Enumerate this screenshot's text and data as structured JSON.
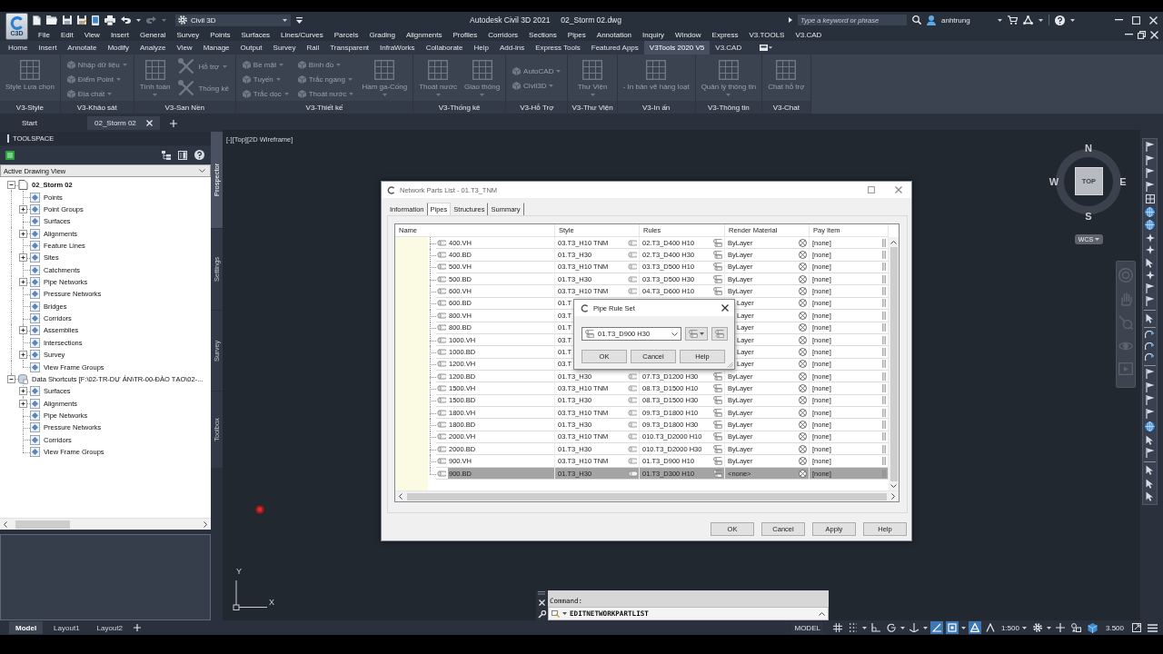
{
  "title_bar": {
    "logo_caption": "C3D",
    "workspace": "Civil 3D",
    "app_title": "Autodesk Civil 3D 2021",
    "file_name": "02_Storm 02.dwg",
    "search": {
      "placeholder": "Type a keyword or phrase"
    },
    "user": "anhtrung"
  },
  "menu_bar": [
    "File",
    "Edit",
    "View",
    "Insert",
    "General",
    "Survey",
    "Points",
    "Surfaces",
    "Lines/Curves",
    "Parcels",
    "Grading",
    "Alignments",
    "Profiles",
    "Corridors",
    "Sections",
    "Pipes",
    "Annotation",
    "Inquiry",
    "Window",
    "Express",
    "V3.TOOLS",
    "V3.CAD"
  ],
  "ribbon": {
    "tabs": [
      {
        "label": "Home",
        "selected": false
      },
      {
        "label": "Insert",
        "selected": false
      },
      {
        "label": "Annotate",
        "selected": false
      },
      {
        "label": "Modify",
        "selected": false
      },
      {
        "label": "Analyze",
        "selected": false
      },
      {
        "label": "View",
        "selected": false
      },
      {
        "label": "Manage",
        "selected": false
      },
      {
        "label": "Output",
        "selected": false
      },
      {
        "label": "Survey",
        "selected": false
      },
      {
        "label": "Rail",
        "selected": false
      },
      {
        "label": "Transparent",
        "selected": false
      },
      {
        "label": "InfraWorks",
        "selected": false
      },
      {
        "label": "Collaborate",
        "selected": false
      },
      {
        "label": "Help",
        "selected": false
      },
      {
        "label": "Add-ins",
        "selected": false
      },
      {
        "label": "Express Tools",
        "selected": false
      },
      {
        "label": "Featured Apps",
        "selected": false
      },
      {
        "label": "V3Tools 2020 V5",
        "selected": true
      },
      {
        "label": "V3.CAD",
        "selected": false
      }
    ],
    "panels": [
      {
        "title": "V3-Style",
        "tools": [
          {
            "label": "Style Lựa chọn",
            "kind": "large",
            "dropdown": false,
            "disabled": true
          }
        ]
      },
      {
        "title": "V3-Khảo sát",
        "tools": [
          {
            "label": "Nhập dữ liệu",
            "kind": "small",
            "dropdown": true,
            "disabled": true
          },
          {
            "label": "Điểm Point",
            "kind": "small",
            "dropdown": true,
            "disabled": true
          },
          {
            "label": "Địa chất",
            "kind": "small",
            "dropdown": true,
            "disabled": true
          }
        ]
      },
      {
        "title": "V3-San Nền",
        "tools": [
          {
            "label": "Tính toán",
            "kind": "large",
            "dropdown": true,
            "disabled": true
          },
          {
            "label": "Hỗ trợ",
            "kind": "medium",
            "dropdown": true,
            "disabled": true
          },
          {
            "label": "Thống kê",
            "kind": "medium",
            "dropdown": false,
            "disabled": true
          }
        ]
      },
      {
        "title": "V3-Thiết kế",
        "tools": [
          {
            "label": "Bề mặt",
            "kind": "small",
            "dropdown": true,
            "disabled": true
          },
          {
            "label": "Tuyến",
            "kind": "small",
            "dropdown": true,
            "disabled": true
          },
          {
            "label": "Trắc dọc",
            "kind": "small",
            "dropdown": true,
            "disabled": true
          },
          {
            "label": "Bình đồ",
            "kind": "small",
            "dropdown": true,
            "disabled": true
          },
          {
            "label": "Trắc ngang",
            "kind": "small",
            "dropdown": true,
            "disabled": true
          },
          {
            "label": "Thoát nước",
            "kind": "small",
            "dropdown": true,
            "disabled": true
          },
          {
            "label": "Hầm ga-Cống",
            "kind": "large",
            "dropdown": true,
            "disabled": true
          }
        ]
      },
      {
        "title": "V3-Thống kê",
        "tools": [
          {
            "label": "Thoát nước",
            "kind": "large",
            "dropdown": true,
            "disabled": true
          },
          {
            "label": "Giao thông",
            "kind": "large",
            "dropdown": true,
            "disabled": true
          }
        ]
      },
      {
        "title": "V3-Hỗ Trợ",
        "tools": [
          {
            "label": "AutoCAD",
            "kind": "small",
            "dropdown": true,
            "disabled": true
          },
          {
            "label": "Civil3D",
            "kind": "small",
            "dropdown": true,
            "disabled": true
          }
        ]
      },
      {
        "title": "V3-Thư Viện",
        "tools": [
          {
            "label": "Thư Viện",
            "kind": "large",
            "dropdown": true,
            "disabled": true
          }
        ]
      },
      {
        "title": "V3-In ấn",
        "tools": [
          {
            "label": "- In bản vẽ hàng loạt",
            "kind": "large",
            "dropdown": false,
            "disabled": true
          }
        ]
      },
      {
        "title": "V3-Thông tin",
        "tools": [
          {
            "label": "Quản lý thông tin",
            "kind": "large",
            "dropdown": true,
            "disabled": true
          }
        ]
      },
      {
        "title": "V3-Chat",
        "tools": [
          {
            "label": "Chat hỗ trợ",
            "kind": "large",
            "dropdown": false,
            "disabled": true
          }
        ]
      }
    ]
  },
  "file_tabs": [
    {
      "label": "Start",
      "selected": false
    },
    {
      "label": "02_Storm 02",
      "selected": true
    }
  ],
  "toolspace": {
    "title": "TOOLSPACE",
    "view": "Active Drawing View",
    "tree": [
      {
        "label": "02_Storm 02",
        "kind": "drawing",
        "expanded": true,
        "children": [
          {
            "label": "Points"
          },
          {
            "label": "Point Groups",
            "expanded": false
          },
          {
            "label": "Surfaces"
          },
          {
            "label": "Alignments",
            "expanded": false
          },
          {
            "label": "Feature Lines"
          },
          {
            "label": "Sites",
            "expanded": false
          },
          {
            "label": "Catchments"
          },
          {
            "label": "Pipe Networks",
            "expanded": false
          },
          {
            "label": "Pressure Networks"
          },
          {
            "label": "Bridges"
          },
          {
            "label": "Corridors"
          },
          {
            "label": "Assemblies",
            "expanded": false
          },
          {
            "label": "Intersections"
          },
          {
            "label": "Survey",
            "expanded": false
          },
          {
            "label": "View Frame Groups"
          }
        ]
      },
      {
        "label": "Data Shortcuts [F:\\02-TR-DỰ ÁN\\TR-00-ĐÀO TẠO\\02-...",
        "kind": "shortcuts",
        "expanded": true,
        "children": [
          {
            "label": "Surfaces",
            "expanded": false
          },
          {
            "label": "Alignments",
            "expanded": false
          },
          {
            "label": "Pipe Networks"
          },
          {
            "label": "Pressure Networks"
          },
          {
            "label": "Corridors"
          },
          {
            "label": "View Frame Groups"
          }
        ]
      }
    ],
    "side_tabs": [
      {
        "label": "Prospector",
        "selected": true
      },
      {
        "label": "Settings",
        "selected": false
      },
      {
        "label": "Survey",
        "selected": false
      },
      {
        "label": "Toolbox",
        "selected": false
      }
    ]
  },
  "viewport": {
    "controls": "[-][Top][2D Wireframe]",
    "view_cube": {
      "north": "N",
      "west": "W",
      "east": "E",
      "south": "S",
      "face": "TOP",
      "ucs": "WCS"
    },
    "ucs_icon": {
      "y_axis": "Y",
      "x_axis": "X"
    }
  },
  "dialog": {
    "title": "Network Parts List - 01.T3_TNM",
    "tabs": [
      {
        "label": "Information",
        "selected": false
      },
      {
        "label": "Pipes",
        "selected": true
      },
      {
        "label": "Structures",
        "selected": false
      },
      {
        "label": "Summary",
        "selected": false
      }
    ],
    "table": {
      "columns": [
        "Name",
        "Style",
        "Rules",
        "Render Material",
        "Pay Item"
      ],
      "rows": [
        {
          "name": "400.VH",
          "style": "03.T3_H10 TNM",
          "rules": "02.T3_D400 H10",
          "render_material": "ByLayer",
          "pay_item": "[none]",
          "selected": false
        },
        {
          "name": "400.BD",
          "style": "01.T3_H30",
          "rules": "02.T3_D400 H30",
          "render_material": "ByLayer",
          "pay_item": "[none]",
          "selected": false
        },
        {
          "name": "500.VH",
          "style": "03.T3_H10 TNM",
          "rules": "03.T3_D500 H10",
          "render_material": "ByLayer",
          "pay_item": "[none]",
          "selected": false
        },
        {
          "name": "500.BD",
          "style": "01.T3_H30",
          "rules": "03.T3_D500 H30",
          "render_material": "ByLayer",
          "pay_item": "[none]",
          "selected": false
        },
        {
          "name": "600.VH",
          "style": "03.T3_H10 TNM",
          "rules": "04.T3_D600 H10",
          "render_material": "ByLayer",
          "pay_item": "[none]",
          "selected": false
        },
        {
          "name": "600.BD",
          "style": "01.T",
          "render_material": "Layer",
          "pay_item": "[none]",
          "selected": false
        },
        {
          "name": "800.VH",
          "style": "03.T",
          "render_material": "Layer",
          "pay_item": "[none]",
          "selected": false
        },
        {
          "name": "800.BD",
          "style": "01.T",
          "render_material": "Layer",
          "pay_item": "[none]",
          "selected": false
        },
        {
          "name": "1000.VH",
          "style": "03.T",
          "render_material": "Layer",
          "pay_item": "[none]",
          "selected": false
        },
        {
          "name": "1000.BD",
          "style": "01.T",
          "render_material": "Layer",
          "pay_item": "[none]",
          "selected": false
        },
        {
          "name": "1200.VH",
          "style": "03.T",
          "render_material": "Layer",
          "pay_item": "[none]",
          "selected": false
        },
        {
          "name": "1200.BD",
          "style": "01.T3_H30",
          "rules": "07.T3_D1200 H30",
          "render_material": "ByLayer",
          "pay_item": "[none]",
          "selected": false
        },
        {
          "name": "1500.VH",
          "style": "03.T3_H10 TNM",
          "rules": "08.T3_D1500 H10",
          "render_material": "ByLayer",
          "pay_item": "[none]",
          "selected": false
        },
        {
          "name": "1500.BD",
          "style": "01.T3_H30",
          "rules": "08.T3_D1500 H30",
          "render_material": "ByLayer",
          "pay_item": "[none]",
          "selected": false
        },
        {
          "name": "1800.VH",
          "style": "03.T3_H10 TNM",
          "rules": "09.T3_D1800 H10",
          "render_material": "ByLayer",
          "pay_item": "[none]",
          "selected": false
        },
        {
          "name": "1800.BD",
          "style": "01.T3_H30",
          "rules": "09.T3_D1800 H30",
          "render_material": "ByLayer",
          "pay_item": "[none]",
          "selected": false
        },
        {
          "name": "2000.VH",
          "style": "03.T3_H10 TNM",
          "rules": "010.T3_D2000 H10",
          "render_material": "ByLayer",
          "pay_item": "[none]",
          "selected": false
        },
        {
          "name": "2000.BD",
          "style": "01.T3_H30",
          "rules": "010.T3_D2000 H30",
          "render_material": "ByLayer",
          "pay_item": "[none]",
          "selected": false
        },
        {
          "name": "900.VH",
          "style": "03.T3_H10 TNM",
          "rules": "01.T3_D900 H10",
          "render_material": "ByLayer",
          "pay_item": "[none]",
          "selected": false
        },
        {
          "name": "900.BD",
          "style": "01.T3_H30",
          "rules": "01.T3_D300 H10",
          "render_material": "<none>",
          "pay_item": "[none]",
          "selected": true
        }
      ]
    },
    "buttons": [
      "OK",
      "Cancel",
      "Apply",
      "Help"
    ],
    "rule_set_dialog": {
      "title": "Pipe Rule Set",
      "value": "01.T3_D900 H30",
      "buttons": [
        "OK",
        "Cancel",
        "Help"
      ]
    }
  },
  "command_line": {
    "prompt": "Command:",
    "value": "EDITNETWORKPARTLIST"
  },
  "layout_tabs": [
    {
      "label": "Model",
      "selected": true
    },
    {
      "label": "Layout1",
      "selected": false
    },
    {
      "label": "Layout2",
      "selected": false
    }
  ],
  "status_bar": {
    "mode": "MODEL",
    "toggles": [
      {
        "on": false
      },
      {
        "on": false
      },
      {
        "on": false
      },
      {
        "on": false
      },
      {
        "on": false
      },
      {
        "on": true
      },
      {
        "on": true
      },
      {
        "on": true
      },
      {
        "on": false
      }
    ],
    "scale": "1:500",
    "value": "3.500"
  }
}
